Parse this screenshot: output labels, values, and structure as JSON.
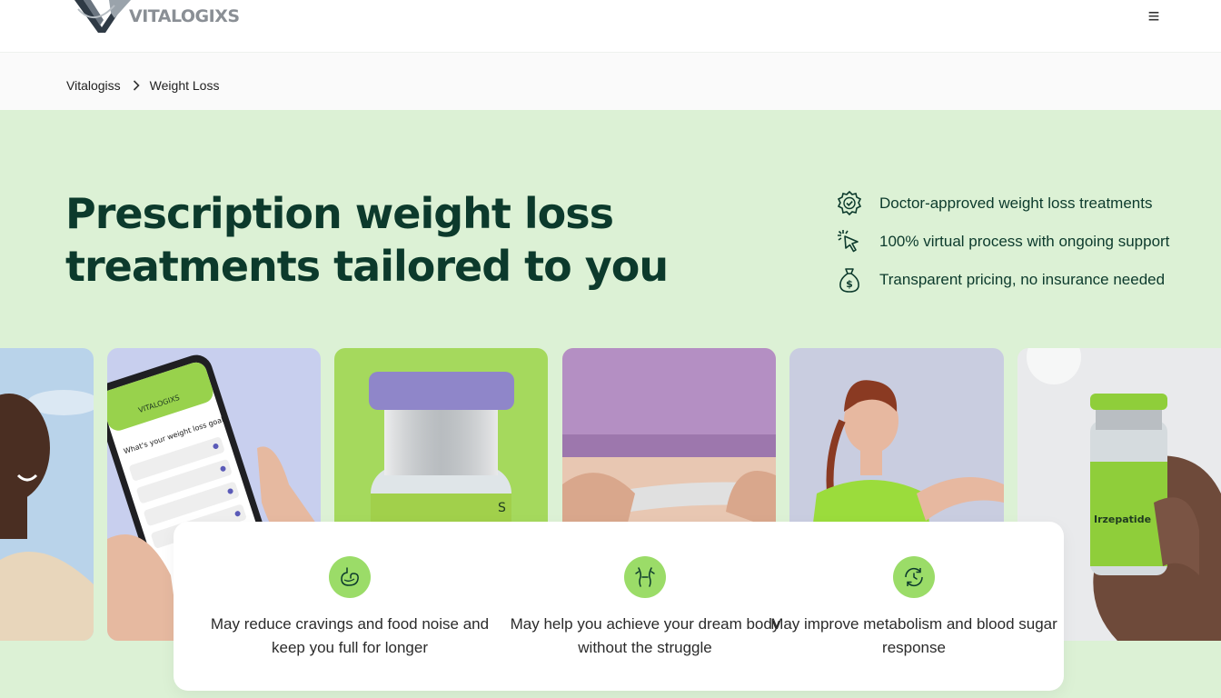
{
  "header": {
    "logo_text": "VITALOGIXS",
    "logo_icon": "vx-logo-mark",
    "menu_icon": "hamburger-menu-icon",
    "menu_glyph": "≡"
  },
  "breadcrumb": {
    "items": [
      "Vitalogiss",
      "Weight Loss"
    ],
    "separator_icon": "chevron-right-icon"
  },
  "hero": {
    "title": "Prescription weight loss treatments tailored to you",
    "benefits": [
      {
        "icon": "verified-badge-icon",
        "text": "Doctor-approved weight loss treatments"
      },
      {
        "icon": "pointer-click-icon",
        "text": "100% virtual process with ongoing support"
      },
      {
        "icon": "money-bag-icon",
        "text": "Transparent pricing, no insurance needed"
      }
    ]
  },
  "gallery": {
    "images": [
      {
        "name": "photo-smiling-man"
      },
      {
        "name": "photo-phone-questionnaire",
        "phone_title": "VITALOGIXS",
        "phone_question": "What's your weight loss goal?"
      },
      {
        "name": "photo-purple-vial"
      },
      {
        "name": "photo-measuring-tape"
      },
      {
        "name": "photo-woman-stretching"
      },
      {
        "name": "photo-green-vial",
        "vial_label": "Irzepatide"
      }
    ]
  },
  "features": [
    {
      "icon": "stomach-icon",
      "text": "May reduce cravings and food noise and keep you full for longer"
    },
    {
      "icon": "body-icon",
      "text": "May help you achieve your dream body without the struggle"
    },
    {
      "icon": "metabolism-clock-icon",
      "text": "May improve metabolism and blood sugar response"
    }
  ],
  "colors": {
    "brand_dark_green": "#0c3a2c",
    "hero_background": "#dcf1d5",
    "accent_lime": "#9bdc68",
    "logo_grey": "#8a8f95"
  }
}
